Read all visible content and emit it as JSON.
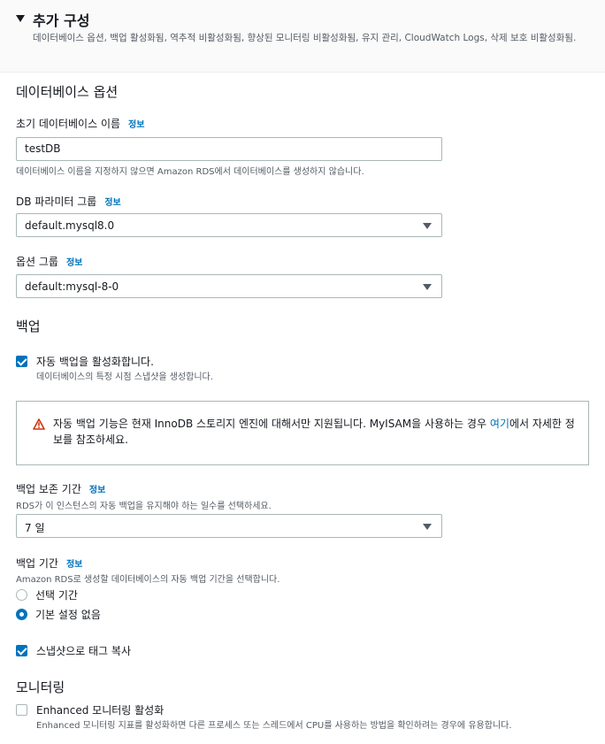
{
  "section": {
    "title": "추가 구성",
    "description": "데이터베이스 옵션, 백업 활성화됨, 역추적 비활성화됨, 향상된 모니터링 비활성화됨, 유지 관리, CloudWatch Logs, 삭제 보호 비활성화됨."
  },
  "db_options": {
    "heading": "데이터베이스 옵션",
    "initial_db_name": {
      "label": "초기 데이터베이스 이름",
      "info": "정보",
      "value": "testDB",
      "hint": "데이터베이스 이름을 지정하지 않으면 Amazon RDS에서 데이터베이스를 생성하지 않습니다."
    },
    "param_group": {
      "label": "DB 파라미터 그룹",
      "info": "정보",
      "value": "default.mysql8.0"
    },
    "option_group": {
      "label": "옵션 그룹",
      "info": "정보",
      "value": "default:mysql-8-0"
    }
  },
  "backup": {
    "heading": "백업",
    "auto_backup": {
      "checked": true,
      "label": "자동 백업을 활성화합니다.",
      "description": "데이터베이스의 특정 시점 스냅샷을 생성합니다."
    },
    "alert": {
      "text": "자동 백업 기능은 현재 InnoDB 스토리지 엔진에 대해서만 지원됩니다. MyISAM을 사용하는 경우",
      "link": "여기",
      "text_after": "에서 자세한 정보를 참조하세요."
    },
    "retention": {
      "label": "백업 보존 기간",
      "info": "정보",
      "hint": "RDS가 이 인스턴스의 자동 백업을 유지해야 하는 일수를 선택하세요.",
      "value": "7 일"
    },
    "window": {
      "label": "백업 기간",
      "info": "정보",
      "hint": "Amazon RDS로 생성할 데이터베이스의 자동 백업 기간을 선택합니다.",
      "options": [
        {
          "label": "선택 기간",
          "selected": false
        },
        {
          "label": "기본 설정 없음",
          "selected": true
        }
      ]
    },
    "copy_tags": {
      "checked": true,
      "label": "스냅샷으로 태그 복사"
    }
  },
  "monitoring": {
    "heading": "모니터링",
    "enhanced": {
      "checked": false,
      "label": "Enhanced 모니터링 활성화",
      "description": "Enhanced 모니터링 지표를 활성화하면 다른 프로세스 또는 스레드에서 CPU를 사용하는 방법을 확인하려는 경우에 유용합니다."
    }
  },
  "colors": {
    "accent": "#0073bb",
    "warning": "#d13212"
  }
}
